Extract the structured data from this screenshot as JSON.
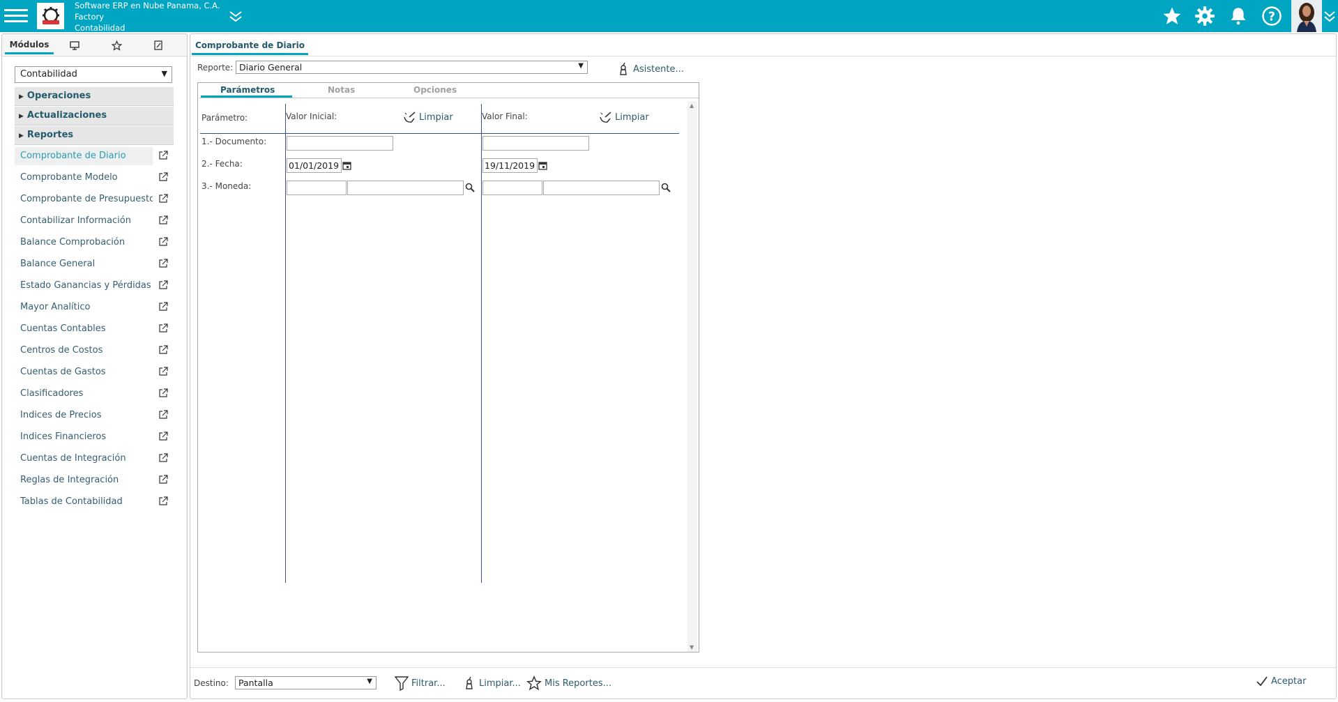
{
  "header": {
    "company_line1": "Software ERP en Nube Panama, C.A.",
    "company_line2": "Factory",
    "company_line3": "Contabilidad"
  },
  "left": {
    "tabs": {
      "modulos": "Módulos"
    },
    "module_selected": "Contabilidad",
    "sections": {
      "operaciones": "Operaciones",
      "actualizaciones": "Actualizaciones",
      "reportes": "Reportes"
    },
    "items": [
      "Comprobante de Diario",
      "Comprobante Modelo",
      "Comprobante de Presupuesto",
      "Contabilizar Información",
      "Balance Comprobación",
      "Balance General",
      "Estado Ganancias y Pérdidas",
      "Mayor Analítico",
      "Cuentas Contables",
      "Centros de Costos",
      "Cuentas de Gastos",
      "Clasificadores",
      "Indices de Precios",
      "Indices Financieros",
      "Cuentas de Integración",
      "Reglas de Integración",
      "Tablas de Contabilidad"
    ]
  },
  "main": {
    "tab_title": "Comprobante de Diario",
    "reporte_label": "Reporte:",
    "reporte_value": "Diario General",
    "asistente_label": "Asistente...",
    "param_tabs": {
      "parametros": "Parámetros",
      "notas": "Notas",
      "opciones": "Opciones"
    },
    "col_parametro": "Parámetro:",
    "col_valor_inicial": "Valor Inicial:",
    "col_valor_final": "Valor Final:",
    "limpiar": "Limpiar",
    "params": {
      "documento": "1.- Documento:",
      "fecha": "2.- Fecha:",
      "moneda": "3.- Moneda:"
    },
    "fecha_inicial": "01/01/2019",
    "fecha_final": "19/11/2019"
  },
  "footer": {
    "destino_label": "Destino:",
    "destino_value": "Pantalla",
    "filtrar": "Filtrar...",
    "limpiar": "Limpiar...",
    "mis_reportes": "Mis Reportes...",
    "aceptar": "Aceptar"
  },
  "colors": {
    "accent": "#00a5c2",
    "link": "#355f6f"
  }
}
